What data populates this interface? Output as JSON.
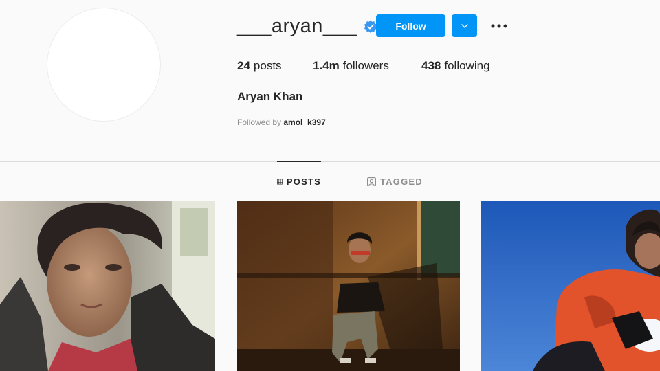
{
  "profile": {
    "username": "___aryan___",
    "verified": true,
    "follow_label": "Follow",
    "stats": {
      "posts_count": "24",
      "posts_label": "posts",
      "followers_count": "1.4m",
      "followers_label": "followers",
      "following_count": "438",
      "following_label": "following"
    },
    "full_name": "Aryan Khan",
    "followed_by_prefix": "Followed by",
    "followed_by_user": "amol_k397"
  },
  "tabs": [
    {
      "label": "POSTS",
      "icon": "grid-icon",
      "active": true
    },
    {
      "label": "TAGGED",
      "icon": "tagged-icon",
      "active": false
    }
  ],
  "posts": [
    {
      "description": "close-up portrait in black jacket and red shirt"
    },
    {
      "description": "seated in dark room with sunlight and shadows"
    },
    {
      "description": "orange jacket against blue sky in snow"
    }
  ],
  "colors": {
    "accent": "#0095f6",
    "background": "#fafafa",
    "text": "#262626",
    "muted": "#8e8e8e"
  }
}
